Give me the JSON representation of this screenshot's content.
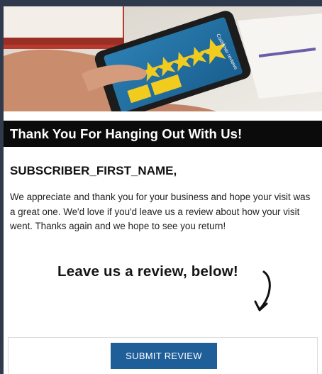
{
  "hero": {
    "screen_title": "Customer reviews",
    "star_color": "#f2cb1f"
  },
  "header": {
    "title": "Thank You For Hanging Out With Us!"
  },
  "content": {
    "greeting": "SUBSCRIBER_FIRST_NAME,",
    "paragraph": "We appreciate and thank you for your business and hope your visit was a great one. We'd love if you'd leave us a review about how your visit went. Thanks again and we hope to see you return!",
    "review_prompt": "Leave us a review, below!"
  },
  "cta": {
    "button_label": "SUBMIT REVIEW",
    "button_color": "#1f5f99"
  },
  "colors": {
    "page_background": "#2f3b4c",
    "title_bar": "#0b0b0b"
  }
}
